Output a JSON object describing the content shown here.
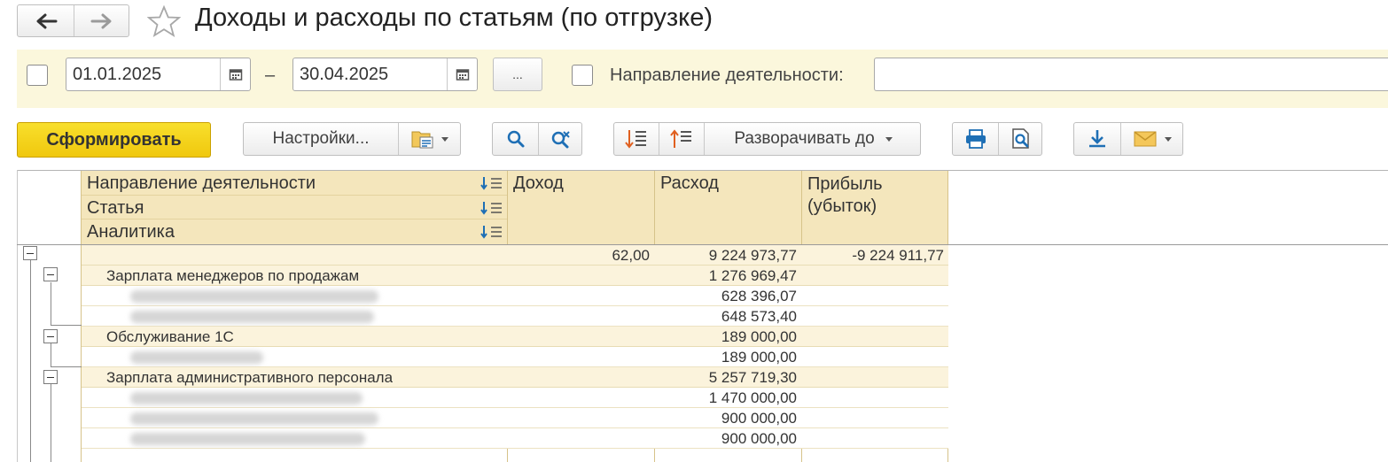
{
  "window": {
    "title": "Доходы и расходы по статьям (по отгрузке)"
  },
  "filters": {
    "date_from": "01.01.2025",
    "date_separator": "–",
    "date_to": "30.04.2025",
    "period_button": "...",
    "direction_label": "Направление деятельности:",
    "direction_value": ""
  },
  "toolbar": {
    "generate": "Сформировать",
    "settings": "Настройки...",
    "expand_to": "Разворачивать до"
  },
  "table": {
    "headers": {
      "group_1": "Направление деятельности",
      "group_2": "Статья",
      "group_3": "Аналитика",
      "income": "Доход",
      "expense": "Расход",
      "profit": "Прибыль (убыток)"
    },
    "rows": [
      {
        "label": "",
        "income": "62,00",
        "expense": "9 224 973,77",
        "profit": "-9 224 911,77"
      },
      {
        "label": "Зарплата менеджеров по продажам",
        "income": "",
        "expense": "1 276 969,47",
        "profit": ""
      },
      {
        "label": "",
        "income": "",
        "expense": "628 396,07",
        "profit": ""
      },
      {
        "label": "",
        "income": "",
        "expense": "648 573,40",
        "profit": ""
      },
      {
        "label": "Обслуживание 1С",
        "income": "",
        "expense": "189 000,00",
        "profit": ""
      },
      {
        "label": "",
        "income": "",
        "expense": "189 000,00",
        "profit": ""
      },
      {
        "label": "Зарплата административного персонала",
        "income": "",
        "expense": "5 257 719,30",
        "profit": ""
      },
      {
        "label": "",
        "income": "",
        "expense": "1 470 000,00",
        "profit": ""
      },
      {
        "label": "",
        "income": "",
        "expense": "900 000,00",
        "profit": ""
      },
      {
        "label": "",
        "income": "",
        "expense": "900 000,00",
        "profit": ""
      }
    ]
  },
  "colors": {
    "generate_button": "#f0c80e",
    "panel_background": "#fbf7dc",
    "table_header": "#f4e6bc",
    "row_group": "#fbf3dc",
    "accent_icon": "#1e6fb5"
  },
  "icons": [
    "back-arrow-icon",
    "forward-arrow-icon",
    "star-icon",
    "calendar-icon",
    "report-variant-icon",
    "search-icon",
    "search-cancel-icon",
    "sort-desc-icon",
    "sort-asc-icon",
    "print-icon",
    "preview-icon",
    "save-icon",
    "mail-icon",
    "collapse-icon"
  ]
}
